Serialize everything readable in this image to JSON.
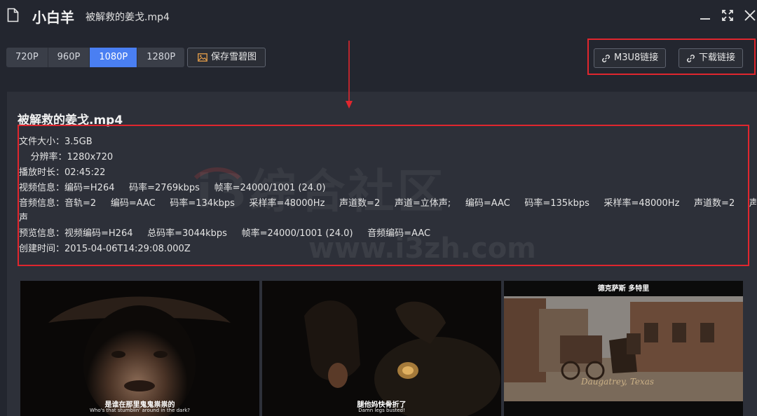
{
  "titlebar": {
    "app_name": "小白羊",
    "file_name": "被解救的姜戈.mp4"
  },
  "toolbar": {
    "resolutions": [
      {
        "label": "720P",
        "active": false
      },
      {
        "label": "960P",
        "active": false
      },
      {
        "label": "1080P",
        "active": true
      },
      {
        "label": "1280P",
        "active": false
      }
    ],
    "save_label": "保存雪碧图",
    "m3u8_label": "M3U8链接",
    "download_label": "下载链接"
  },
  "info": {
    "title": "被解救的姜戈.mp4",
    "lines": [
      "文件大小：3.5GB",
      "    分辨率：1280x720",
      "播放时长：02:45:22",
      "视频信息：编码=H264     码率=2769kbps     帧率=24000/1001 (24.0)",
      "音频信息：音轨=2     编码=AAC     码率=134kbps     采样率=48000Hz     声道数=2     声道=立体声;     编码=AAC     码率=135kbps     采样率=48000Hz     声道数=2     声道=立体",
      "声",
      "预览信息：视频编码=H264     总码率=3044kbps     帧率=24000/1001 (24.0)     音频编码=AAC",
      "创建时间：2015-04-06T14:29:08.000Z"
    ]
  },
  "watermark": {
    "text": "i3综合社区",
    "url": "www.i3zh.com"
  },
  "thumbnails": [
    {
      "sub_cn": "是谁在那里鬼鬼祟祟的",
      "sub_en": "Who's that stumblin' around in the dark?"
    },
    {
      "sub_cn": "腿他妈快骨折了",
      "sub_en": "Damn legs busted!"
    },
    {
      "top_caption": "德克萨斯  多特里",
      "street": "Daugatrey, Texas"
    }
  ]
}
